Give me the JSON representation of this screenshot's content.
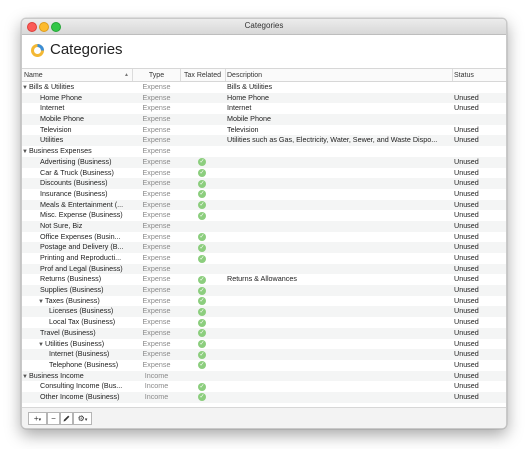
{
  "window": {
    "title": "Categories"
  },
  "header": {
    "title": "Categories"
  },
  "columns": {
    "name": "Name",
    "type": "Type",
    "tax": "Tax Related",
    "description": "Description",
    "status": "Status"
  },
  "colors": {
    "check": "#8cce7e",
    "logo_yellow": "#f3b834",
    "logo_blue": "#3b8ed8"
  },
  "rows": [
    {
      "name": "Bills & Utilities",
      "level": 0,
      "disclosure": "▼",
      "type": "Expense",
      "tax": false,
      "description": "Bills & Utilities",
      "status": ""
    },
    {
      "name": "Home Phone",
      "level": 1,
      "disclosure": "",
      "type": "Expense",
      "tax": false,
      "description": "Home Phone",
      "status": "Unused"
    },
    {
      "name": "Internet",
      "level": 1,
      "disclosure": "",
      "type": "Expense",
      "tax": false,
      "description": "Internet",
      "status": "Unused"
    },
    {
      "name": "Mobile Phone",
      "level": 1,
      "disclosure": "",
      "type": "Expense",
      "tax": false,
      "description": "Mobile Phone",
      "status": ""
    },
    {
      "name": "Television",
      "level": 1,
      "disclosure": "",
      "type": "Expense",
      "tax": false,
      "description": "Television",
      "status": "Unused"
    },
    {
      "name": "Utilities",
      "level": 1,
      "disclosure": "",
      "type": "Expense",
      "tax": false,
      "description": "Utilities such as Gas, Electricity, Water, Sewer, and Waste Dispo...",
      "status": "Unused"
    },
    {
      "name": "Business Expenses",
      "level": 0,
      "disclosure": "▼",
      "type": "Expense",
      "tax": false,
      "description": "",
      "status": ""
    },
    {
      "name": "Advertising (Business)",
      "level": 1,
      "disclosure": "",
      "type": "Expense",
      "tax": true,
      "description": "",
      "status": "Unused"
    },
    {
      "name": "Car & Truck (Business)",
      "level": 1,
      "disclosure": "",
      "type": "Expense",
      "tax": true,
      "description": "",
      "status": "Unused"
    },
    {
      "name": "Discounts (Business)",
      "level": 1,
      "disclosure": "",
      "type": "Expense",
      "tax": true,
      "description": "",
      "status": "Unused"
    },
    {
      "name": "Insurance (Business)",
      "level": 1,
      "disclosure": "",
      "type": "Expense",
      "tax": true,
      "description": "",
      "status": "Unused"
    },
    {
      "name": "Meals & Entertainment (...",
      "level": 1,
      "disclosure": "",
      "type": "Expense",
      "tax": true,
      "description": "",
      "status": "Unused"
    },
    {
      "name": "Misc. Expense (Business)",
      "level": 1,
      "disclosure": "",
      "type": "Expense",
      "tax": true,
      "description": "",
      "status": "Unused"
    },
    {
      "name": "Not Sure, Biz",
      "level": 1,
      "disclosure": "",
      "type": "Expense",
      "tax": false,
      "description": "",
      "status": "Unused"
    },
    {
      "name": "Office Expenses (Busin...",
      "level": 1,
      "disclosure": "",
      "type": "Expense",
      "tax": true,
      "description": "",
      "status": "Unused"
    },
    {
      "name": "Postage and Delivery (B...",
      "level": 1,
      "disclosure": "",
      "type": "Expense",
      "tax": true,
      "description": "",
      "status": "Unused"
    },
    {
      "name": "Printing and Reproducti...",
      "level": 1,
      "disclosure": "",
      "type": "Expense",
      "tax": true,
      "description": "",
      "status": "Unused"
    },
    {
      "name": "Prof and Legal (Business)",
      "level": 1,
      "disclosure": "",
      "type": "Expense",
      "tax": false,
      "description": "",
      "status": "Unused"
    },
    {
      "name": "Returns (Business)",
      "level": 1,
      "disclosure": "",
      "type": "Expense",
      "tax": true,
      "description": "Returns & Allowances",
      "status": "Unused"
    },
    {
      "name": "Supplies (Business)",
      "level": 1,
      "disclosure": "",
      "type": "Expense",
      "tax": true,
      "description": "",
      "status": "Unused"
    },
    {
      "name": "Taxes (Business)",
      "level": 1,
      "disclosure": "▼",
      "type": "Expense",
      "tax": true,
      "description": "",
      "status": "Unused"
    },
    {
      "name": "Licenses (Business)",
      "level": 2,
      "disclosure": "",
      "type": "Expense",
      "tax": true,
      "description": "",
      "status": "Unused"
    },
    {
      "name": "Local Tax (Business)",
      "level": 2,
      "disclosure": "",
      "type": "Expense",
      "tax": true,
      "description": "",
      "status": "Unused"
    },
    {
      "name": "Travel (Business)",
      "level": 1,
      "disclosure": "",
      "type": "Expense",
      "tax": true,
      "description": "",
      "status": "Unused"
    },
    {
      "name": "Utilities (Business)",
      "level": 1,
      "disclosure": "▼",
      "type": "Expense",
      "tax": true,
      "description": "",
      "status": "Unused"
    },
    {
      "name": "Internet (Business)",
      "level": 2,
      "disclosure": "",
      "type": "Expense",
      "tax": true,
      "description": "",
      "status": "Unused"
    },
    {
      "name": "Telephone (Business)",
      "level": 2,
      "disclosure": "",
      "type": "Expense",
      "tax": true,
      "description": "",
      "status": "Unused"
    },
    {
      "name": "Business Income",
      "level": 0,
      "disclosure": "▼",
      "type": "Income",
      "tax": false,
      "description": "",
      "status": "Unused"
    },
    {
      "name": "Consulting Income (Bus...",
      "level": 1,
      "disclosure": "",
      "type": "Income",
      "tax": true,
      "description": "",
      "status": "Unused"
    },
    {
      "name": "Other Income (Business)",
      "level": 1,
      "disclosure": "",
      "type": "Income",
      "tax": true,
      "description": "",
      "status": "Unused"
    }
  ],
  "toolbar": {
    "add_label": "+",
    "add_menu_icon": "chevron-down-icon",
    "remove_label": "−",
    "edit_icon": "pencil-icon",
    "gear_icon": "gear-icon"
  }
}
